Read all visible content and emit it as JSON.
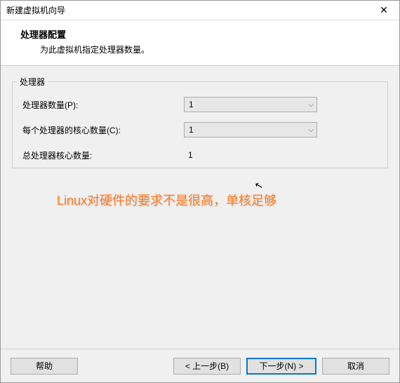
{
  "window": {
    "title": "新建虚拟机向导",
    "close_glyph": "✕"
  },
  "header": {
    "heading": "处理器配置",
    "sub": "为此虚拟机指定处理器数量。"
  },
  "group": {
    "legend": "处理器",
    "rows": {
      "proc_count": {
        "label": "处理器数量(P):",
        "value": "1"
      },
      "cores_per": {
        "label": "每个处理器的核心数量(C):",
        "value": "1"
      },
      "total": {
        "label": "总处理器核心数量:",
        "value": "1"
      }
    }
  },
  "annotation": "Linux对硬件的要求不是很高，单核足够",
  "icons": {
    "chevron_down": "⌵"
  },
  "footer": {
    "help": "帮助",
    "back": "< 上一步(B)",
    "next": "下一步(N) >",
    "cancel": "取消"
  }
}
